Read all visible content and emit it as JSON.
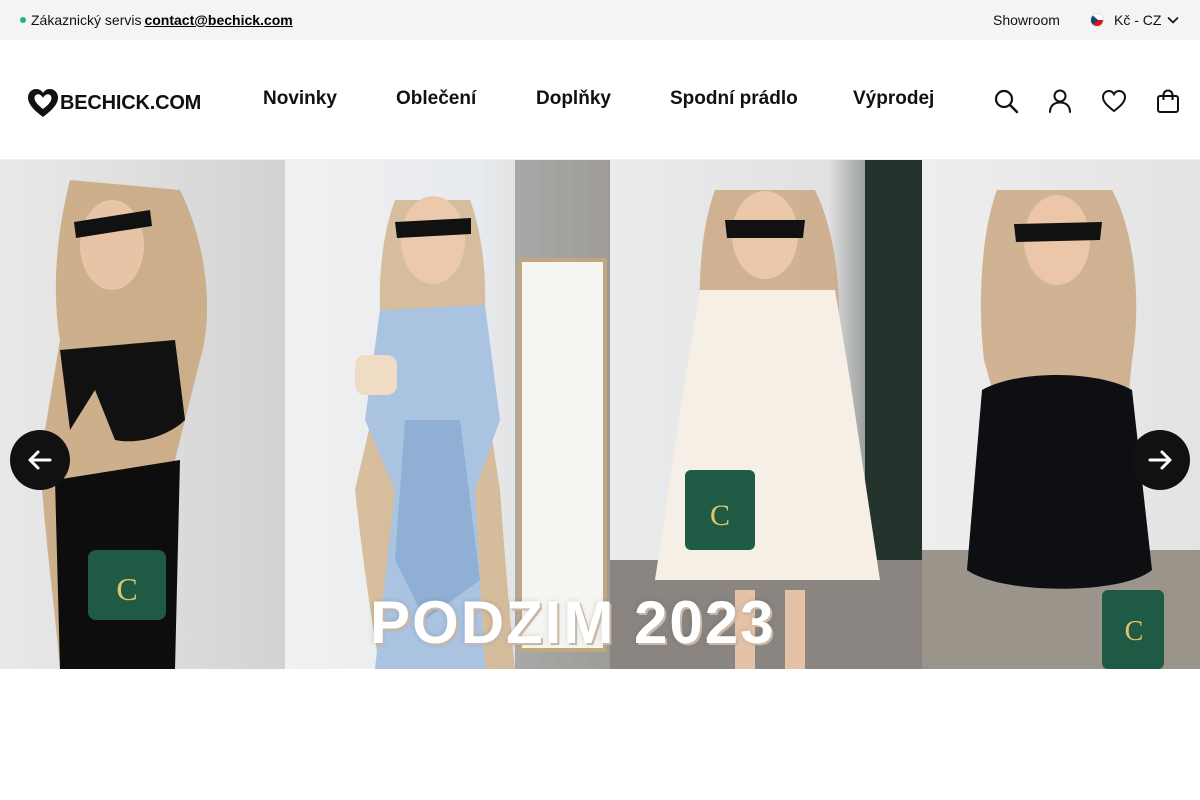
{
  "topbar": {
    "service_label": "Zákaznický servis",
    "email": "contact@bechick.com",
    "showroom": "Showroom",
    "currency": "Kč - CZ"
  },
  "header": {
    "logo_text": "BECHICK.COM",
    "nav": [
      "Novinky",
      "Oblečení",
      "Doplňky",
      "Spodní prádlo",
      "Výprodej"
    ],
    "icons": [
      "search-icon",
      "account-icon",
      "wishlist-heart-icon",
      "cart-bag-icon"
    ]
  },
  "hero": {
    "title": "PODZIM 2023",
    "prev_icon": "arrow-left-icon",
    "next_icon": "arrow-right-icon"
  },
  "colors": {
    "status_dot": "#1fb873",
    "arrow_bg": "#111111",
    "topbar_bg": "#f4f4f4"
  }
}
